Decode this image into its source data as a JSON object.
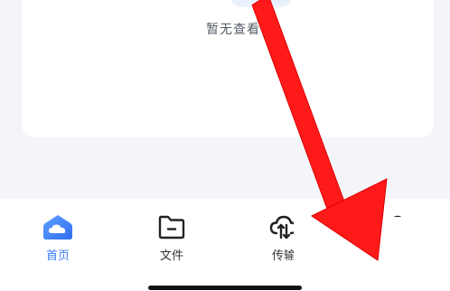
{
  "empty_state": {
    "text": "暂无查看记"
  },
  "tab_bar": {
    "items": [
      {
        "label": "首页",
        "icon": "home-cloud-icon",
        "active": true
      },
      {
        "label": "文件",
        "icon": "folder-icon",
        "active": false
      },
      {
        "label": "传输",
        "icon": "cloud-transfer-icon",
        "active": false
      }
    ]
  },
  "colors": {
    "accent": "#3a7cf5",
    "arrow": "#ff1a1a",
    "background": "#f3f5f9"
  }
}
